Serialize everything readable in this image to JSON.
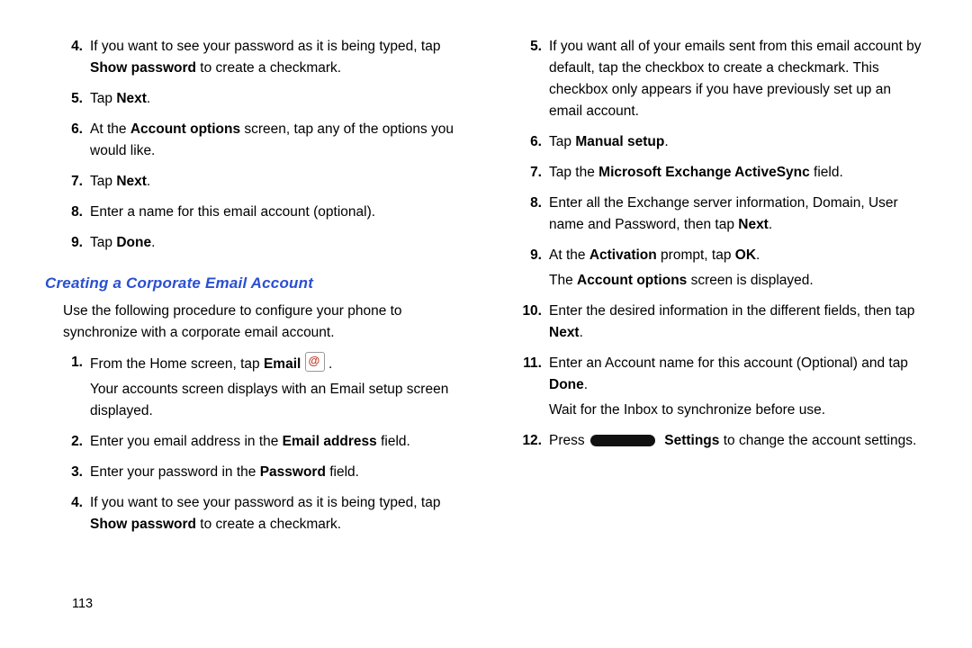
{
  "pageNumber": "113",
  "left": {
    "stepsA": [
      {
        "n": "4.",
        "frags": [
          {
            "t": "If you want to see your password as it is being typed, tap "
          },
          {
            "t": "Show password",
            "b": true
          },
          {
            "t": " to create a checkmark."
          }
        ]
      },
      {
        "n": "5.",
        "frags": [
          {
            "t": "Tap "
          },
          {
            "t": "Next",
            "b": true
          },
          {
            "t": "."
          }
        ]
      },
      {
        "n": "6.",
        "frags": [
          {
            "t": "At the "
          },
          {
            "t": "Account options",
            "b": true
          },
          {
            "t": " screen, tap any of the options you would like."
          }
        ]
      },
      {
        "n": "7.",
        "frags": [
          {
            "t": "Tap "
          },
          {
            "t": "Next",
            "b": true
          },
          {
            "t": "."
          }
        ]
      },
      {
        "n": "8.",
        "frags": [
          {
            "t": "Enter a name for this email account (optional)."
          }
        ]
      },
      {
        "n": "9.",
        "frags": [
          {
            "t": "Tap "
          },
          {
            "t": "Done",
            "b": true
          },
          {
            "t": "."
          }
        ]
      }
    ],
    "heading": "Creating a Corporate Email Account",
    "intro": "Use the following procedure to configure your phone to synchronize with a corporate email account.",
    "stepsB": [
      {
        "n": "1.",
        "paras": [
          {
            "frags": [
              {
                "t": "From the Home screen, tap "
              },
              {
                "t": "Email",
                "b": true
              },
              {
                "t": " "
              },
              {
                "icon": "email"
              },
              {
                "t": " ."
              }
            ]
          },
          {
            "frags": [
              {
                "t": "Your accounts screen displays with an Email setup screen displayed."
              }
            ]
          }
        ]
      },
      {
        "n": "2.",
        "paras": [
          {
            "frags": [
              {
                "t": "Enter you email address in the "
              },
              {
                "t": "Email address",
                "b": true
              },
              {
                "t": " field."
              }
            ]
          }
        ]
      },
      {
        "n": "3.",
        "paras": [
          {
            "frags": [
              {
                "t": "Enter your password in the "
              },
              {
                "t": "Password",
                "b": true
              },
              {
                "t": " field."
              }
            ]
          }
        ]
      },
      {
        "n": "4.",
        "paras": [
          {
            "frags": [
              {
                "t": "If you want to see your password as it is being typed, tap "
              },
              {
                "t": "Show password",
                "b": true
              },
              {
                "t": " to create a checkmark."
              }
            ]
          }
        ]
      }
    ]
  },
  "right": {
    "steps": [
      {
        "n": "5.",
        "paras": [
          {
            "frags": [
              {
                "t": "If you want all of your emails sent from this email account by default, tap the checkbox to create a checkmark. This checkbox only appears if you have previously set up an email account."
              }
            ]
          }
        ]
      },
      {
        "n": "6.",
        "paras": [
          {
            "frags": [
              {
                "t": "Tap "
              },
              {
                "t": "Manual setup",
                "b": true
              },
              {
                "t": "."
              }
            ]
          }
        ]
      },
      {
        "n": "7.",
        "paras": [
          {
            "frags": [
              {
                "t": "Tap the "
              },
              {
                "t": "Microsoft Exchange ActiveSync",
                "b": true
              },
              {
                "t": " field."
              }
            ]
          }
        ]
      },
      {
        "n": "8.",
        "paras": [
          {
            "frags": [
              {
                "t": "Enter all the Exchange server information, Domain, User name and Password, then tap "
              },
              {
                "t": "Next",
                "b": true
              },
              {
                "t": "."
              }
            ]
          }
        ]
      },
      {
        "n": "9.",
        "paras": [
          {
            "frags": [
              {
                "t": "At the "
              },
              {
                "t": "Activation",
                "b": true
              },
              {
                "t": " prompt, tap "
              },
              {
                "t": "OK",
                "b": true
              },
              {
                "t": "."
              }
            ]
          },
          {
            "frags": [
              {
                "t": "The "
              },
              {
                "t": "Account options",
                "b": true
              },
              {
                "t": " screen is displayed."
              }
            ]
          }
        ]
      },
      {
        "n": "10.",
        "paras": [
          {
            "frags": [
              {
                "t": "Enter the desired information in the different fields, then tap "
              },
              {
                "t": "Next",
                "b": true
              },
              {
                "t": "."
              }
            ]
          }
        ]
      },
      {
        "n": "11.",
        "paras": [
          {
            "frags": [
              {
                "t": "Enter an Account name for this account (Optional) and tap "
              },
              {
                "t": "Done",
                "b": true
              },
              {
                "t": "."
              }
            ]
          },
          {
            "frags": [
              {
                "t": "Wait for the Inbox to synchronize before use."
              }
            ]
          }
        ]
      },
      {
        "n": "12.",
        "paras": [
          {
            "frags": [
              {
                "t": "Press "
              },
              {
                "icon": "menu"
              },
              {
                "t": " "
              },
              {
                "t": "Settings",
                "b": true
              },
              {
                "t": " to change the account settings."
              }
            ]
          }
        ]
      }
    ]
  }
}
